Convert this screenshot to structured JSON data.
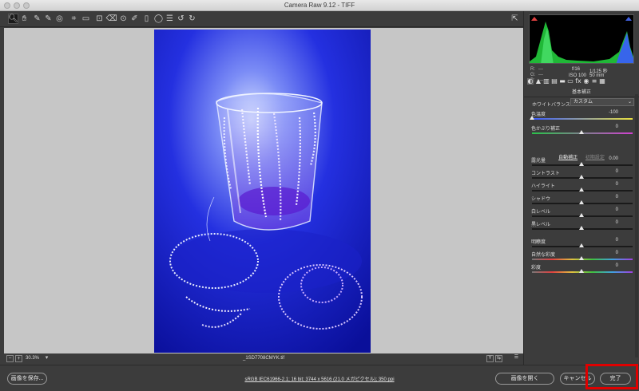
{
  "window": {
    "title": "Camera Raw 9.12  -  TIFF"
  },
  "toolbar": {
    "tools": [
      {
        "name": "zoom-tool-icon",
        "glyph": "🔍︎"
      },
      {
        "name": "hand-tool-icon",
        "glyph": "✋︎"
      },
      {
        "name": "white-balance-tool-icon",
        "glyph": "✎"
      },
      {
        "name": "color-sampler-tool-icon",
        "glyph": "✎"
      },
      {
        "name": "targeted-adjustment-tool-icon",
        "glyph": "◎"
      },
      {
        "name": "crop-tool-icon",
        "glyph": "⌗"
      },
      {
        "name": "straighten-tool-icon",
        "glyph": "▭"
      },
      {
        "name": "transform-tool-icon",
        "glyph": "⊡"
      },
      {
        "name": "spot-removal-tool-icon",
        "glyph": "⌫"
      },
      {
        "name": "red-eye-tool-icon",
        "glyph": "⊙"
      },
      {
        "name": "adjustment-brush-icon",
        "glyph": "✐"
      },
      {
        "name": "graduated-filter-icon",
        "glyph": "▯"
      },
      {
        "name": "radial-filter-icon",
        "glyph": "◯"
      },
      {
        "name": "preferences-icon",
        "glyph": "☰"
      },
      {
        "name": "rotate-left-icon",
        "glyph": "↺"
      },
      {
        "name": "rotate-right-icon",
        "glyph": "↻"
      }
    ],
    "fullscreen_glyph": "⇱"
  },
  "canvas": {
    "zoom_minus": "−",
    "zoom_plus": "+",
    "zoom_value": "30.3%",
    "zoom_dropdown": "▾",
    "filename": "_1SD7708CMYK.tif",
    "view_y": "Y",
    "view_compare": "⇆",
    "view_settings": "☰"
  },
  "histogram": {
    "r_label": "R:",
    "g_label": "G:",
    "b_label": "B:",
    "r_value": "---",
    "g_value": "---",
    "b_value": "---",
    "aperture": "f/16",
    "shutter": "1/125 秒",
    "iso": "ISO 100",
    "focal": "50 mm"
  },
  "panel": {
    "tabs": [
      "◐",
      "▲",
      "▥",
      "▤",
      "▬",
      "▭",
      "fx",
      "◉",
      "≡",
      "▦"
    ],
    "section_title": "基本補正",
    "wb_label": "ホワイトバランス：",
    "wb_value": "カスタム",
    "auto_label": "自動補正",
    "default_label": "初期設定",
    "sliders": [
      {
        "label": "色温度",
        "value": "-100",
        "pos": 0.0,
        "track": "temp"
      },
      {
        "label": "色かぶり補正",
        "value": "0",
        "pos": 0.5,
        "track": "tint"
      },
      {
        "label": "露光量",
        "value": "0.00",
        "pos": 0.5,
        "track": "plain"
      },
      {
        "label": "コントラスト",
        "value": "0",
        "pos": 0.5,
        "track": "plain"
      },
      {
        "label": "ハイライト",
        "value": "0",
        "pos": 0.5,
        "track": "plain"
      },
      {
        "label": "シャドウ",
        "value": "0",
        "pos": 0.5,
        "track": "plain"
      },
      {
        "label": "白レベル",
        "value": "0",
        "pos": 0.5,
        "track": "plain"
      },
      {
        "label": "黒レベル",
        "value": "0",
        "pos": 0.5,
        "track": "plain"
      },
      {
        "label": "明瞭度",
        "value": "0",
        "pos": 0.5,
        "track": "plain"
      },
      {
        "label": "自然な彩度",
        "value": "0",
        "pos": 0.5,
        "track": "vibrance"
      },
      {
        "label": "彩度",
        "value": "0",
        "pos": 0.5,
        "track": "saturation"
      }
    ]
  },
  "bottom": {
    "save_label": "画像を保存...",
    "workflow_text": "sRGB IEC61966-2.1; 16 bit; 3744 x 5616 (21.0 メガピクセル); 350 ppi",
    "open_label": "画像を開く",
    "cancel_label": "キャンセル",
    "done_label": "完了"
  }
}
